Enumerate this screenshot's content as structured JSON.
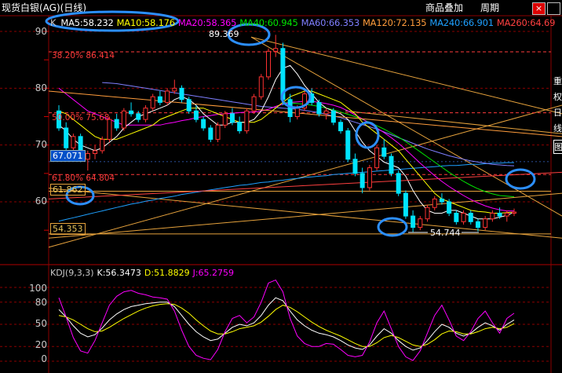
{
  "window": {
    "title": "现货白银(AG)(日线)",
    "menu_item": "商品叠加",
    "period_label": "周期",
    "close_symbol": "×",
    "scroll_symbol": "K"
  },
  "colors": {
    "background": "#000000",
    "up": "#ff3232",
    "down": "#00e4ff",
    "ma5": "#ffffff",
    "ma10": "#ffff00",
    "ma20": "#ff00ff",
    "ma40": "#00e400",
    "ma60": "#7f7fff",
    "ma120": "#ff9c3c",
    "ma240": "#1ea0ff",
    "ma260": "#ff4040",
    "grid": "#8b0000",
    "highlight": "#2c8fff"
  },
  "ma_legend": [
    {
      "label": "MA5:58.232",
      "color": "#ffffff"
    },
    {
      "label": "MA10:58.176",
      "color": "#ffff00"
    },
    {
      "label": "MA20:58.365",
      "color": "#ff00ff"
    },
    {
      "label": "MA40:60.945",
      "color": "#00e400"
    },
    {
      "label": "MA60:66.353",
      "color": "#7f7fff"
    },
    {
      "label": "MA120:72.135",
      "color": "#ff9c3c"
    },
    {
      "label": "MA240:66.901",
      "color": "#1ea0ff"
    },
    {
      "label": "MA260:64.69",
      "color": "#ff4040"
    }
  ],
  "kdj_legend": [
    {
      "label": "KDJ(9,3,3)",
      "color": "#c8c8c8"
    },
    {
      "label": "K:56.3473",
      "color": "#ffffff"
    },
    {
      "label": "D:51.8829",
      "color": "#ffff00"
    },
    {
      "label": "J:65.2759",
      "color": "#ff00ff"
    }
  ],
  "price_ticks": [
    "90",
    "80",
    "70",
    "60"
  ],
  "kdj_ticks": [
    "100",
    "80",
    "50",
    "20",
    "0"
  ],
  "right_glyphs": [
    "重",
    "权",
    "日",
    "线",
    "图"
  ],
  "annotations": {
    "high": "89.369",
    "low": "54.744",
    "current": "67.071",
    "level_61": "61.862",
    "level_54": "54.353",
    "fib_38": "38.20% 86.414",
    "fib_50": "50.00% 75.68",
    "fib_618": "61.80% 64.804"
  },
  "chart_data": [
    {
      "type": "candlestick",
      "title": "现货白银(AG)(日线)",
      "ylim": [
        50,
        91
      ],
      "ohlc": [
        [
          76.0,
          77.0,
          72.5,
          73.0
        ],
        [
          73.0,
          74.0,
          69.0,
          69.5
        ],
        [
          69.5,
          72.0,
          68.5,
          71.5
        ],
        [
          71.5,
          72.0,
          67.0,
          67.5
        ],
        [
          67.5,
          69.0,
          65.5,
          68.5
        ],
        [
          68.5,
          70.0,
          67.5,
          69.0
        ],
        [
          69.0,
          71.5,
          68.5,
          71.0
        ],
        [
          71.0,
          75.0,
          70.5,
          74.5
        ],
        [
          74.5,
          75.5,
          72.5,
          73.0
        ],
        [
          73.0,
          76.5,
          72.5,
          76.0
        ],
        [
          76.0,
          77.5,
          75.0,
          75.5
        ],
        [
          75.5,
          76.0,
          74.0,
          74.5
        ],
        [
          74.5,
          77.0,
          74.0,
          76.5
        ],
        [
          76.5,
          79.0,
          76.0,
          78.5
        ],
        [
          78.5,
          79.5,
          77.0,
          77.5
        ],
        [
          77.5,
          80.0,
          77.0,
          79.5
        ],
        [
          79.5,
          81.5,
          79.0,
          80.0
        ],
        [
          80.0,
          80.5,
          77.5,
          78.0
        ],
        [
          78.0,
          78.5,
          75.5,
          76.0
        ],
        [
          76.0,
          77.0,
          74.0,
          74.5
        ],
        [
          74.5,
          75.0,
          72.5,
          73.0
        ],
        [
          73.0,
          73.5,
          70.5,
          71.0
        ],
        [
          71.0,
          74.0,
          70.5,
          73.5
        ],
        [
          73.5,
          76.0,
          73.0,
          75.5
        ],
        [
          75.5,
          76.5,
          73.5,
          74.0
        ],
        [
          74.0,
          75.0,
          72.0,
          72.5
        ],
        [
          72.5,
          76.5,
          72.0,
          76.0
        ],
        [
          76.0,
          79.0,
          75.5,
          78.5
        ],
        [
          78.5,
          82.5,
          78.0,
          82.0
        ],
        [
          82.0,
          87.0,
          81.5,
          86.5
        ],
        [
          86.5,
          89.4,
          85.5,
          87.0
        ],
        [
          87.0,
          88.0,
          77.0,
          78.0
        ],
        [
          78.0,
          79.0,
          74.0,
          75.0
        ],
        [
          75.0,
          77.0,
          74.5,
          76.5
        ],
        [
          76.5,
          79.5,
          76.0,
          79.0
        ],
        [
          79.0,
          80.0,
          77.0,
          77.5
        ],
        [
          77.5,
          78.0,
          75.0,
          75.5
        ],
        [
          75.5,
          76.5,
          74.5,
          76.0
        ],
        [
          76.0,
          76.5,
          73.5,
          74.0
        ],
        [
          74.0,
          74.5,
          72.0,
          72.5
        ],
        [
          72.5,
          73.0,
          67.0,
          67.5
        ],
        [
          67.5,
          68.5,
          64.5,
          65.0
        ],
        [
          65.0,
          66.0,
          61.5,
          62.5
        ],
        [
          62.5,
          66.5,
          62.0,
          66.0
        ],
        [
          66.0,
          70.0,
          65.5,
          69.5
        ],
        [
          69.5,
          71.0,
          67.5,
          68.0
        ],
        [
          68.0,
          68.5,
          64.5,
          65.0
        ],
        [
          65.0,
          65.5,
          61.0,
          61.5
        ],
        [
          61.5,
          62.0,
          57.0,
          57.5
        ],
        [
          57.5,
          58.5,
          54.7,
          55.5
        ],
        [
          55.5,
          57.5,
          55.0,
          57.0
        ],
        [
          57.0,
          59.5,
          56.5,
          59.0
        ],
        [
          59.0,
          61.0,
          58.5,
          60.5
        ],
        [
          60.5,
          61.5,
          59.5,
          60.0
        ],
        [
          60.0,
          60.5,
          57.5,
          58.0
        ],
        [
          58.0,
          58.5,
          56.0,
          56.5
        ],
        [
          56.5,
          58.5,
          56.0,
          58.0
        ],
        [
          58.0,
          58.5,
          56.0,
          56.5
        ],
        [
          56.5,
          57.0,
          54.8,
          55.5
        ],
        [
          55.5,
          57.5,
          55.0,
          57.0
        ],
        [
          57.0,
          58.5,
          56.5,
          58.0
        ],
        [
          58.0,
          59.0,
          57.0,
          57.5
        ],
        [
          57.5,
          58.5,
          56.5,
          58.0
        ],
        [
          58.0,
          58.8,
          57.5,
          58.2
        ]
      ],
      "ma5": [
        73.5,
        72.5,
        71.0,
        70.0,
        69.5,
        69.0,
        69.5,
        70.5,
        71.5,
        73.0,
        74.0,
        75.0,
        75.5,
        76.0,
        76.5,
        77.0,
        78.0,
        78.5,
        78.0,
        77.0,
        75.5,
        74.5,
        73.5,
        73.5,
        74.0,
        74.0,
        74.0,
        74.5,
        76.0,
        78.5,
        81.5,
        83.5,
        84.0,
        82.5,
        80.5,
        79.0,
        77.5,
        76.5,
        76.0,
        75.5,
        74.5,
        72.5,
        70.5,
        69.0,
        68.0,
        67.0,
        66.5,
        66.0,
        64.5,
        62.0,
        60.0,
        58.5,
        58.0,
        58.0,
        58.5,
        58.5,
        58.0,
        57.5,
        57.0,
        57.0,
        57.0,
        57.3,
        57.6,
        58.2
      ],
      "ma10": [
        76.0,
        75.5,
        74.5,
        73.5,
        72.5,
        71.5,
        71.0,
        71.0,
        71.0,
        71.5,
        72.0,
        72.5,
        73.0,
        73.5,
        74.5,
        75.0,
        75.5,
        76.0,
        76.5,
        76.5,
        76.5,
        76.0,
        75.5,
        75.0,
        74.5,
        74.0,
        74.0,
        74.0,
        74.5,
        75.5,
        76.5,
        77.5,
        78.5,
        79.0,
        79.5,
        79.5,
        79.0,
        78.5,
        78.0,
        77.5,
        76.5,
        75.5,
        74.0,
        73.0,
        72.0,
        71.0,
        70.0,
        69.0,
        67.5,
        66.0,
        64.5,
        63.0,
        61.5,
        60.5,
        60.0,
        59.5,
        59.0,
        58.5,
        58.3,
        58.2,
        58.0,
        58.0,
        58.1,
        58.2
      ],
      "ma20": [
        80.0,
        79.0,
        78.0,
        77.0,
        76.0,
        75.5,
        75.0,
        74.5,
        74.0,
        73.5,
        73.5,
        73.5,
        73.5,
        73.5,
        73.5,
        73.8,
        74.0,
        74.3,
        74.5,
        74.8,
        75.0,
        75.2,
        75.4,
        75.5,
        75.6,
        75.7,
        75.8,
        75.8,
        76.0,
        76.3,
        76.8,
        77.2,
        77.5,
        77.6,
        77.7,
        77.7,
        77.5,
        77.3,
        77.0,
        76.6,
        76.0,
        75.3,
        74.6,
        73.8,
        73.0,
        72.2,
        71.3,
        70.3,
        69.2,
        68.0,
        66.8,
        65.7,
        64.6,
        63.6,
        62.7,
        61.9,
        61.1,
        60.4,
        59.8,
        59.3,
        58.9,
        58.6,
        58.4,
        58.4
      ],
      "ma40": [
        null,
        null,
        null,
        null,
        null,
        null,
        null,
        null,
        null,
        null,
        null,
        null,
        null,
        null,
        null,
        null,
        null,
        null,
        null,
        null,
        null,
        null,
        null,
        null,
        null,
        null,
        null,
        null,
        null,
        null,
        null,
        77.5,
        77.4,
        77.3,
        77.2,
        77.0,
        76.8,
        76.5,
        76.2,
        75.8,
        75.4,
        75.0,
        74.5,
        74.0,
        73.4,
        72.8,
        72.1,
        71.4,
        70.6,
        69.7,
        68.8,
        67.9,
        67.0,
        66.1,
        65.2,
        64.4,
        63.6,
        62.9,
        62.3,
        61.8,
        61.4,
        61.1,
        61.0,
        60.9
      ],
      "ma60": [
        null,
        null,
        null,
        null,
        null,
        null,
        81.0,
        80.9,
        80.8,
        80.6,
        80.4,
        80.2,
        80.0,
        79.8,
        79.6,
        79.4,
        79.2,
        79.0,
        78.8,
        78.6,
        78.4,
        78.2,
        78.0,
        77.8,
        77.6,
        77.4,
        77.2,
        77.0,
        76.8,
        76.7,
        76.6,
        76.5,
        76.4,
        76.3,
        76.1,
        75.9,
        75.7,
        75.4,
        75.1,
        74.8,
        74.4,
        74.0,
        73.6,
        73.2,
        72.8,
        72.3,
        71.8,
        71.3,
        70.8,
        70.3,
        69.8,
        69.3,
        68.9,
        68.5,
        68.1,
        67.8,
        67.5,
        67.2,
        67.0,
        66.8,
        66.6,
        66.5,
        66.4,
        66.35
      ],
      "ma120": [
        null,
        null,
        null,
        null,
        null,
        null,
        null,
        null,
        null,
        null,
        null,
        null,
        null,
        null,
        null,
        null,
        null,
        null,
        null,
        null,
        null,
        null,
        null,
        null,
        null,
        null,
        null,
        null,
        null,
        null,
        null,
        null,
        null,
        null,
        null,
        null,
        null,
        null,
        null,
        null,
        null,
        null,
        null,
        null,
        null,
        null,
        null,
        null,
        null,
        null,
        null,
        null,
        null,
        null,
        null,
        null,
        null,
        null,
        null,
        null,
        null,
        null,
        null,
        72.1
      ],
      "ma240": [
        56.6,
        56.9,
        57.2,
        57.5,
        57.8,
        58.1,
        58.4,
        58.7,
        59.0,
        59.3,
        59.6,
        59.8,
        60.1,
        60.3,
        60.6,
        60.8,
        61.0,
        61.3,
        61.5,
        61.7,
        61.9,
        62.1,
        62.3,
        62.5,
        62.7,
        62.9,
        63.0,
        63.2,
        63.4,
        63.5,
        63.7,
        63.8,
        64.0,
        64.1,
        64.3,
        64.4,
        64.5,
        64.6,
        64.8,
        64.9,
        65.0,
        65.1,
        65.2,
        65.3,
        65.4,
        65.5,
        65.6,
        65.7,
        65.8,
        65.9,
        66.0,
        66.1,
        66.2,
        66.3,
        66.4,
        66.4,
        66.5,
        66.6,
        66.6,
        66.7,
        66.8,
        66.8,
        66.9,
        66.9
      ],
      "ma260": [
        null,
        null,
        null,
        null,
        null,
        null,
        null,
        null,
        null,
        null,
        null,
        null,
        null,
        null,
        null,
        null,
        null,
        null,
        null,
        null,
        null,
        null,
        null,
        null,
        null,
        null,
        null,
        null,
        null,
        null,
        null,
        null,
        null,
        null,
        null,
        null,
        null,
        null,
        null,
        null,
        null,
        null,
        null,
        null,
        null,
        null,
        null,
        null,
        null,
        null,
        null,
        null,
        null,
        null,
        null,
        null,
        null,
        null,
        null,
        null,
        null,
        null,
        null,
        64.69
      ],
      "horizontal_levels": [
        61.862,
        54.353,
        86.414,
        75.68,
        64.804
      ],
      "current_price": 67.071,
      "high": 89.369,
      "low": 54.744
    },
    {
      "type": "line",
      "title": "KDJ(9,3,3)",
      "ylim": [
        0,
        110
      ],
      "series": [
        {
          "name": "K",
          "values": [
            70,
            60,
            48,
            38,
            33,
            36,
            45,
            56,
            64,
            70,
            74,
            76,
            78,
            79,
            80,
            80,
            74,
            62,
            50,
            40,
            33,
            28,
            30,
            38,
            46,
            50,
            48,
            52,
            62,
            76,
            86,
            82,
            68,
            56,
            48,
            42,
            38,
            36,
            33,
            28,
            22,
            18,
            16,
            22,
            34,
            44,
            38,
            28,
            20,
            15,
            18,
            28,
            40,
            50,
            46,
            38,
            34,
            38,
            46,
            52,
            48,
            42,
            50,
            56
          ]
        },
        {
          "name": "D",
          "values": [
            62,
            60,
            56,
            50,
            44,
            40,
            41,
            46,
            52,
            58,
            63,
            68,
            72,
            75,
            77,
            78,
            77,
            72,
            65,
            56,
            48,
            41,
            37,
            37,
            40,
            44,
            46,
            48,
            53,
            61,
            70,
            76,
            73,
            67,
            60,
            53,
            47,
            42,
            38,
            34,
            29,
            24,
            20,
            20,
            25,
            32,
            35,
            32,
            27,
            22,
            20,
            23,
            29,
            37,
            41,
            40,
            37,
            37,
            40,
            44,
            46,
            44,
            46,
            51
          ]
        },
        {
          "name": "J",
          "values": [
            86,
            60,
            32,
            14,
            11,
            28,
            52,
            76,
            88,
            94,
            96,
            92,
            90,
            87,
            86,
            84,
            68,
            42,
            20,
            8,
            4,
            2,
            16,
            40,
            58,
            62,
            52,
            60,
            80,
            106,
            118,
            94,
            58,
            34,
            24,
            20,
            20,
            24,
            23,
            16,
            8,
            6,
            8,
            26,
            52,
            68,
            44,
            20,
            6,
            1,
            14,
            38,
            62,
            76,
            56,
            34,
            28,
            40,
            58,
            68,
            52,
            38,
            58,
            65
          ]
        }
      ]
    }
  ]
}
